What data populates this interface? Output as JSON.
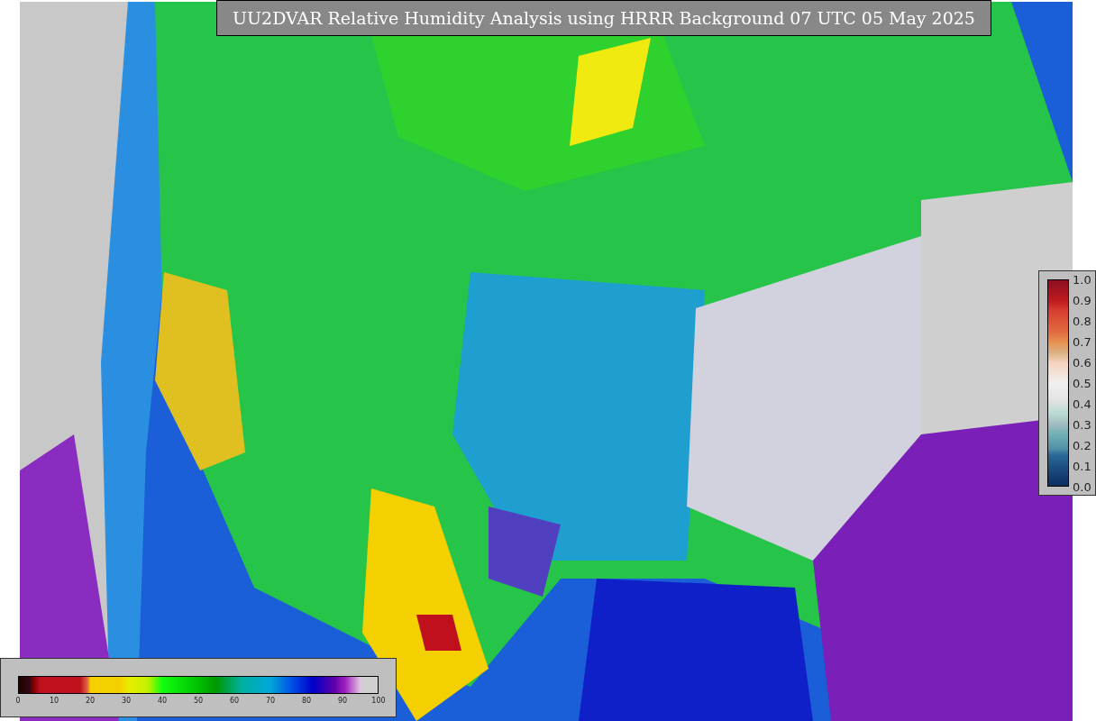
{
  "title": "UU2DVAR Relative Humidity Analysis using HRRR Background 07 UTC 05 May 2025",
  "humidity_colorbar": {
    "ticks": [
      "0",
      "10",
      "20",
      "30",
      "40",
      "50",
      "60",
      "70",
      "80",
      "90",
      "100"
    ]
  },
  "station_colorbar": {
    "ticks": [
      "1.0",
      "0.9",
      "0.8",
      "0.7",
      "0.6",
      "0.5",
      "0.4",
      "0.3",
      "0.2",
      "0.1",
      "0.0"
    ]
  }
}
